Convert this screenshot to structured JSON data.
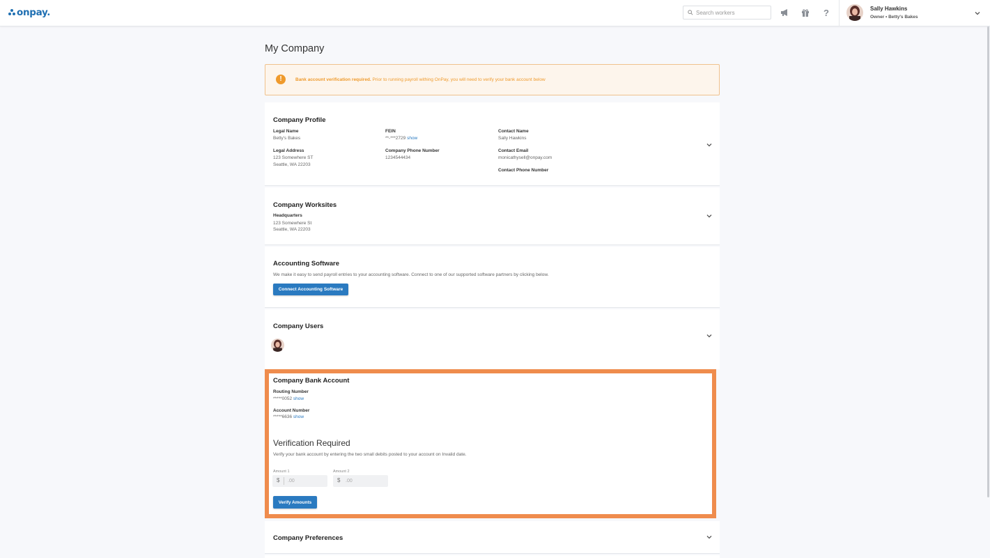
{
  "app": {
    "logo_text": "onpay."
  },
  "header": {
    "search_placeholder": "Search workers",
    "icons": [
      "megaphone-icon",
      "gift-icon",
      "help-icon"
    ],
    "user": {
      "name": "Sally Hawkins",
      "role": "Owner • Betty's Bakes"
    }
  },
  "page": {
    "title": "My Company"
  },
  "alert": {
    "bold": "Bank account verification required.",
    "text": " Prior to running payroll withing OnPay, you will need to verify your bank account below"
  },
  "profile": {
    "title": "Company Profile",
    "legal_name_label": "Legal Name",
    "legal_name": "Betty's Bakes",
    "legal_address_label": "Legal Address",
    "legal_address_1": "123 Somewhere ST",
    "legal_address_2": "Seattle, WA 22203",
    "fein_label": "FEIN",
    "fein": "**-***2729 ",
    "fein_show": "show",
    "phone_label": "Company Phone Number",
    "phone": "1234544434",
    "contact_name_label": "Contact Name",
    "contact_name": "Sally Hawkins",
    "contact_email_label": "Contact Email",
    "contact_email": "monicathysell@onpay.com",
    "contact_phone_label": "Contact Phone Number"
  },
  "worksites": {
    "title": "Company Worksites",
    "name": "Headquarters",
    "address_1": "123 Somewhere St",
    "address_2": "Seattle, WA 22203"
  },
  "accounting": {
    "title": "Accounting Software",
    "description": "We make it easy to send payroll entries to your accounting software. Connect to one of our supported software partners by clicking below.",
    "button": "Connect Accounting Software"
  },
  "users": {
    "title": "Company Users"
  },
  "bank": {
    "title": "Company Bank Account",
    "routing_label": "Routing Number",
    "routing": "*****0052 ",
    "routing_show": "show",
    "account_label": "Account Number",
    "account": "*****6636 ",
    "account_show": "show",
    "verify_title": "Verification Required",
    "verify_text": "Verify your bank account by entering the two small debits posted to your account on Invalid date.",
    "amount1_label": "Amount 1",
    "amount2_label": "Amount 2",
    "currency": "$",
    "amount_placeholder": ".00",
    "button": "Verify Amounts"
  },
  "preferences": {
    "title": "Company Preferences"
  },
  "colors": {
    "accent": "#2a7ac0",
    "warning": "#ef9a2c",
    "highlight": "#ef8c4d"
  }
}
